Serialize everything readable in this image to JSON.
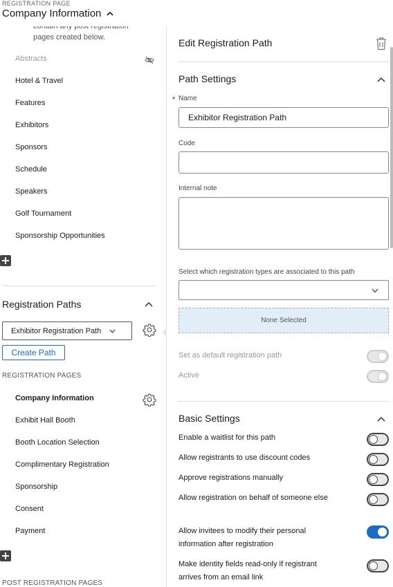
{
  "header": {
    "small_label": "REGISTRATION PAGE",
    "title": "Company Information"
  },
  "left": {
    "description": "contain any post registration pages created below.",
    "pages_top": [
      {
        "label": "Abstracts",
        "hidden": true
      },
      {
        "label": "Hotel & Travel"
      },
      {
        "label": "Features"
      },
      {
        "label": "Exhibitors"
      },
      {
        "label": "Sponsors"
      },
      {
        "label": "Schedule"
      },
      {
        "label": "Speakers"
      },
      {
        "label": "Golf Tournament"
      },
      {
        "label": "Sponsorship Opportunities"
      }
    ],
    "registration_paths_title": "Registration Paths",
    "selected_path": "Exhibitor Registration Path",
    "create_path_label": "Create Path",
    "registration_pages_label": "REGISTRATION PAGES",
    "registration_pages": [
      {
        "label": "Company Information",
        "active": true
      },
      {
        "label": "Exhibit Hall Booth"
      },
      {
        "label": "Booth Location Selection"
      },
      {
        "label": "Complimentary Registration"
      },
      {
        "label": "Sponsorship"
      },
      {
        "label": "Consent"
      },
      {
        "label": "Payment"
      }
    ],
    "post_registration_label": "POST REGISTRATION PAGES"
  },
  "right": {
    "title": "Edit Registration Path",
    "path_settings_title": "Path Settings",
    "name_label": "Name",
    "name_value": "Exhibitor Registration Path",
    "code_label": "Code",
    "code_value": "",
    "note_label": "Internal note",
    "note_value": "",
    "types_label": "Select which registration types are associated to this path",
    "types_value": "",
    "none_selected": "None Selected",
    "default_label": "Set as default registration path",
    "active_label": "Active",
    "basic_settings_title": "Basic Settings",
    "toggles": [
      {
        "label": "Enable a waitlist for this path",
        "on": false
      },
      {
        "label": "Allow registrants to use discount codes",
        "on": false
      },
      {
        "label": "Approve registrations manually",
        "on": false
      },
      {
        "label": "Allow registration on behalf of someone else",
        "on": false
      },
      {
        "label": "Allow invitees to modify their personal information after registration",
        "on": true
      },
      {
        "label": "Make identity fields read-only if registrant arrives from an email link",
        "on": false
      }
    ]
  },
  "colors": {
    "accent": "#1b6bc9",
    "none_selected_bg": "#e3edf7"
  }
}
